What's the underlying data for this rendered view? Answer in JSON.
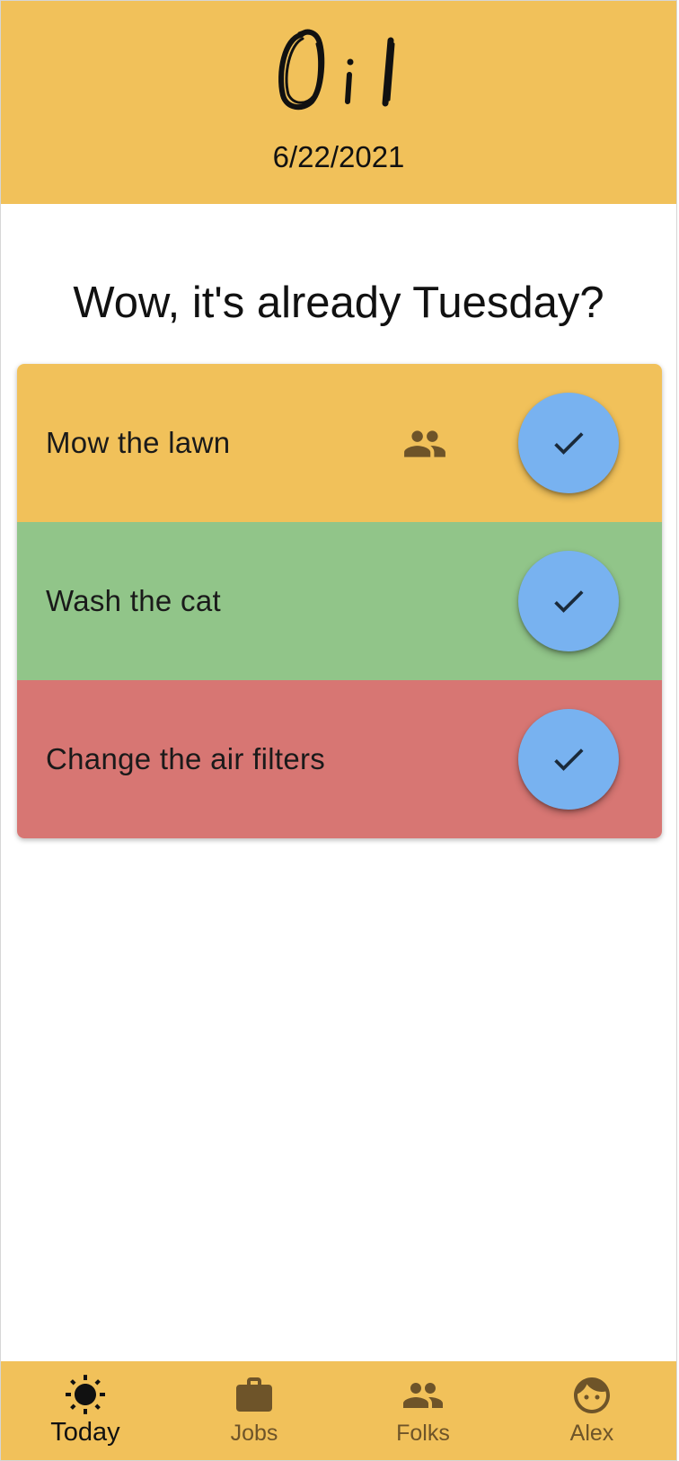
{
  "header": {
    "logo_text": "Oil",
    "date": "6/22/2021",
    "background_color": "#f1c15a"
  },
  "greeting": "Wow, it's already Tuesday?",
  "tasks": [
    {
      "label": "Mow the lawn",
      "color": "#f1c15a",
      "shared": true,
      "shared_icon": "people-icon",
      "action_icon": "check-icon"
    },
    {
      "label": "Wash the cat",
      "color": "#91c589",
      "shared": false,
      "action_icon": "check-icon"
    },
    {
      "label": "Change the air filters",
      "color": "#d77673",
      "shared": false,
      "action_icon": "check-icon"
    }
  ],
  "check_button_color": "#78b2f0",
  "bottom_nav": {
    "items": [
      {
        "label": "Today",
        "icon": "sun-icon",
        "active": true
      },
      {
        "label": "Jobs",
        "icon": "briefcase-icon",
        "active": false
      },
      {
        "label": "Folks",
        "icon": "people-icon",
        "active": false
      },
      {
        "label": "Alex",
        "icon": "face-icon",
        "active": false
      }
    ]
  }
}
